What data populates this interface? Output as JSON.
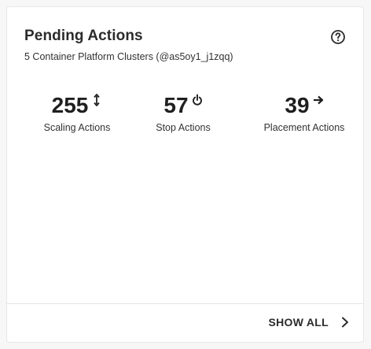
{
  "card": {
    "title": "Pending Actions",
    "subtitle": "5 Container Platform Clusters (@as5oy1_j1zqq)",
    "help_icon": "question-circle-icon"
  },
  "metrics": [
    {
      "value": "255",
      "label": "Scaling Actions",
      "icon": "vertical-arrows-icon"
    },
    {
      "value": "57",
      "label": "Stop Actions",
      "icon": "power-icon"
    },
    {
      "value": "39",
      "label": "Placement Actions",
      "icon": "arrow-right-icon"
    }
  ],
  "footer": {
    "show_all_label": "SHOW ALL",
    "icon": "chevron-right-icon"
  },
  "colors": {
    "text_primary": "#2b2b2b",
    "card_background": "#ffffff",
    "border": "#e6e6e6"
  }
}
